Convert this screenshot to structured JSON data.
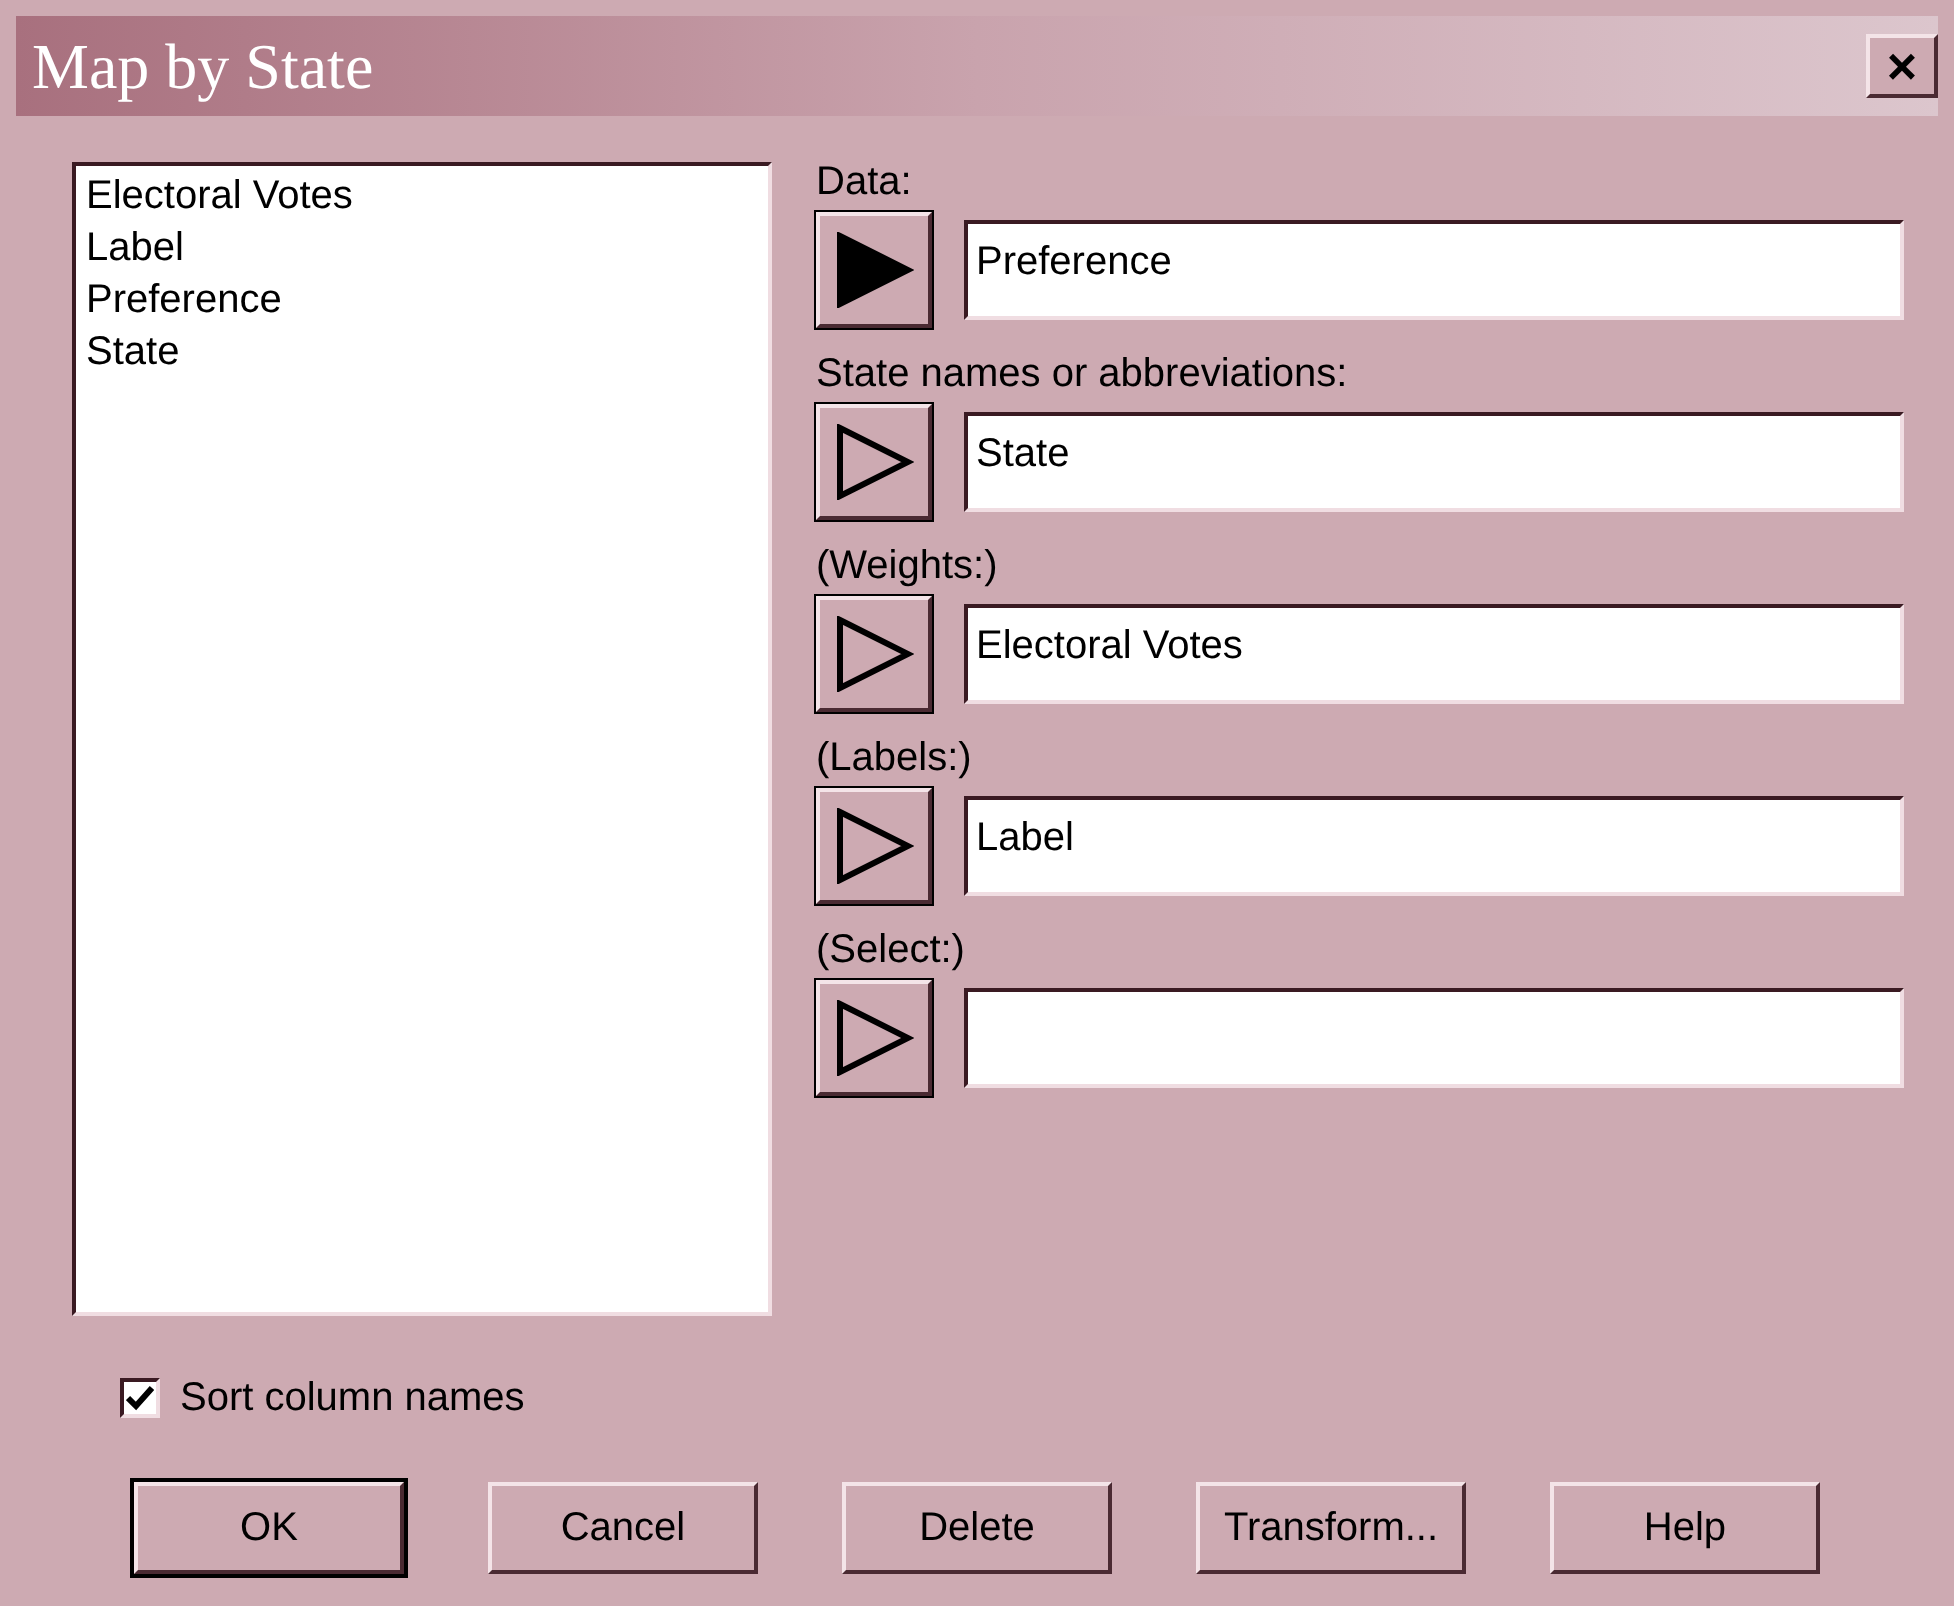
{
  "window": {
    "title": "Map by State",
    "close": "×"
  },
  "column_list": [
    "Electoral Votes",
    "Label",
    "Preference",
    "State"
  ],
  "fields": [
    {
      "label": "Data:",
      "value": "Preference",
      "filled": true
    },
    {
      "label": "State names or abbreviations:",
      "value": "State",
      "filled": false
    },
    {
      "label": "(Weights:)",
      "value": "Electoral Votes",
      "filled": false
    },
    {
      "label": "(Labels:)",
      "value": "Label",
      "filled": false
    },
    {
      "label": "(Select:)",
      "filled": false
    }
  ],
  "sort_checkbox": {
    "label": "Sort column names",
    "checked": true
  },
  "buttons": [
    {
      "label": "OK",
      "default": true
    },
    {
      "label": "Cancel",
      "default": false
    },
    {
      "label": "Delete",
      "default": false
    },
    {
      "label": "Transform...",
      "default": false
    },
    {
      "label": "Help",
      "default": false
    }
  ]
}
